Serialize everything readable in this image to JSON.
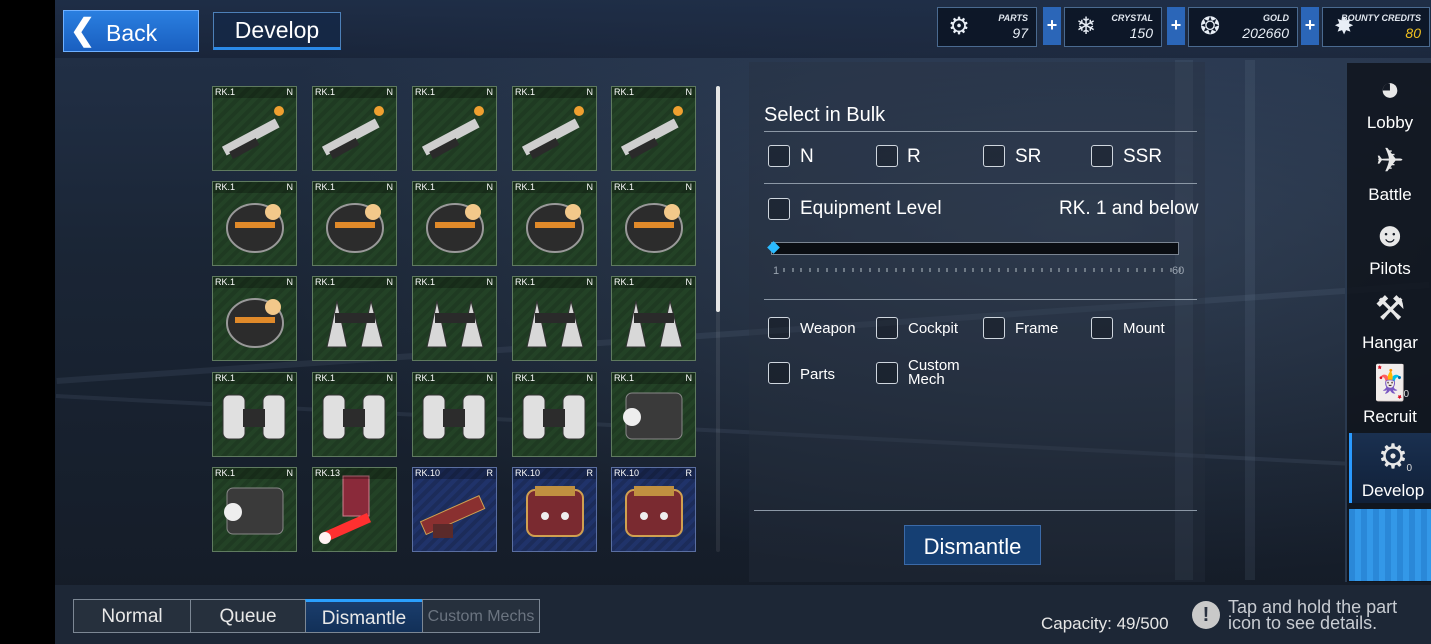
{
  "header": {
    "back_label": "Back",
    "title": "Develop"
  },
  "resources": [
    {
      "label": "PARTS",
      "value": "97",
      "icon": "parts-icon"
    },
    {
      "label": "CRYSTAL",
      "value": "150",
      "icon": "crystal-icon"
    },
    {
      "label": "GOLD",
      "value": "202660",
      "icon": "gold-icon"
    },
    {
      "label": "BOUNTY CREDITS",
      "value": "80",
      "icon": "bounty-credits-icon"
    }
  ],
  "colors": {
    "accent": "#2a9aff",
    "gold_value": "#f0c020",
    "n_cell": "#234226",
    "r_cell": "#20336a"
  },
  "inventory": [
    {
      "rank": "RK.1",
      "rarity": "N",
      "type": "weapon"
    },
    {
      "rank": "RK.1",
      "rarity": "N",
      "type": "weapon"
    },
    {
      "rank": "RK.1",
      "rarity": "N",
      "type": "weapon"
    },
    {
      "rank": "RK.1",
      "rarity": "N",
      "type": "weapon"
    },
    {
      "rank": "RK.1",
      "rarity": "N",
      "type": "weapon"
    },
    {
      "rank": "RK.1",
      "rarity": "N",
      "type": "cockpit"
    },
    {
      "rank": "RK.1",
      "rarity": "N",
      "type": "cockpit"
    },
    {
      "rank": "RK.1",
      "rarity": "N",
      "type": "cockpit"
    },
    {
      "rank": "RK.1",
      "rarity": "N",
      "type": "cockpit"
    },
    {
      "rank": "RK.1",
      "rarity": "N",
      "type": "cockpit"
    },
    {
      "rank": "RK.1",
      "rarity": "N",
      "type": "cockpit"
    },
    {
      "rank": "RK.1",
      "rarity": "N",
      "type": "frame"
    },
    {
      "rank": "RK.1",
      "rarity": "N",
      "type": "frame"
    },
    {
      "rank": "RK.1",
      "rarity": "N",
      "type": "frame"
    },
    {
      "rank": "RK.1",
      "rarity": "N",
      "type": "frame"
    },
    {
      "rank": "RK.1",
      "rarity": "N",
      "type": "mount"
    },
    {
      "rank": "RK.1",
      "rarity": "N",
      "type": "mount"
    },
    {
      "rank": "RK.1",
      "rarity": "N",
      "type": "mount"
    },
    {
      "rank": "RK.1",
      "rarity": "N",
      "type": "mount"
    },
    {
      "rank": "RK.1",
      "rarity": "N",
      "type": "parts"
    },
    {
      "rank": "RK.1",
      "rarity": "N",
      "type": "parts"
    },
    {
      "rank": "RK.13",
      "rarity": "",
      "type": "saber"
    },
    {
      "rank": "RK.10",
      "rarity": "R",
      "type": "weapon-r"
    },
    {
      "rank": "RK.10",
      "rarity": "R",
      "type": "cockpit-r"
    },
    {
      "rank": "RK.10",
      "rarity": "R",
      "type": "cockpit-r"
    }
  ],
  "panel": {
    "bulk_title": "Select in Bulk",
    "rarities": [
      "N",
      "R",
      "SR",
      "SSR"
    ],
    "equipment_level_label": "Equipment Level",
    "level_text": "RK. 1 and below",
    "slider": {
      "min": "1",
      "max": "60",
      "value": 1
    },
    "categories": [
      "Weapon",
      "Cockpit",
      "Frame",
      "Mount",
      "Parts",
      "Custom Mech"
    ],
    "dismantle_label": "Dismantle"
  },
  "nav": [
    {
      "label": "Lobby",
      "icon": "lobby-icon"
    },
    {
      "label": "Battle",
      "icon": "battle-icon"
    },
    {
      "label": "Pilots",
      "icon": "pilots-icon"
    },
    {
      "label": "Hangar",
      "icon": "hangar-icon"
    },
    {
      "label": "Recruit",
      "icon": "recruit-icon",
      "badge": "0"
    },
    {
      "label": "Develop",
      "icon": "develop-icon",
      "badge": "0",
      "active": true
    }
  ],
  "tabs": [
    {
      "label": "Normal"
    },
    {
      "label": "Queue"
    },
    {
      "label": "Dismantle",
      "active": true
    },
    {
      "label": "Custom Mechs",
      "disabled": true
    }
  ],
  "footer": {
    "capacity": "Capacity: 49/500",
    "hint": "Tap and hold the part icon to see details."
  }
}
